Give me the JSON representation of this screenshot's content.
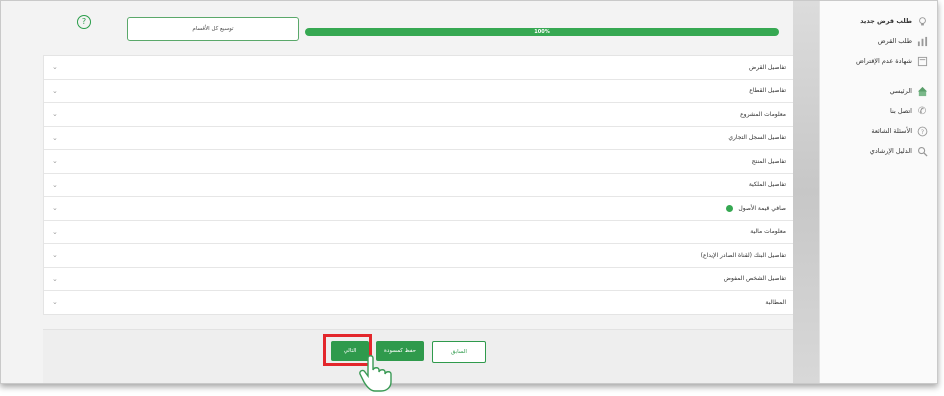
{
  "sidebar": {
    "items": [
      {
        "label": "طلب قرض جديد",
        "icon": "lightbulb-icon"
      },
      {
        "label": "طلب القرض",
        "icon": "bar-chart-icon"
      },
      {
        "label": "شهادة عدم الإقتراض",
        "icon": "document-icon"
      },
      {
        "label": "الرئيسي",
        "icon": "home-icon"
      },
      {
        "label": "اتصل بنا",
        "icon": "phone-icon"
      },
      {
        "label": "الأسئلة الشائعة",
        "icon": "help-circle-icon"
      },
      {
        "label": "الدليل الإرشادي",
        "icon": "search-icon"
      }
    ]
  },
  "header": {
    "help_icon": "?",
    "expand_all_label": "توسيع كل الأقسام",
    "progress_text": "100%",
    "progress_value": 100
  },
  "sections": [
    {
      "label": "تفاصيل القرض",
      "status": ""
    },
    {
      "label": "تفاصيل القطاع",
      "status": ""
    },
    {
      "label": "معلومات المشروع",
      "status": ""
    },
    {
      "label": "تفاصيل السجل التجاري",
      "status": ""
    },
    {
      "label": "تفاصيل المنتج",
      "status": ""
    },
    {
      "label": "تفاصيل الملكية",
      "status": ""
    },
    {
      "label": "صافي قيمة الأصول",
      "status": "complete"
    },
    {
      "label": "معلومات مالية",
      "status": ""
    },
    {
      "label": "تفاصيل البنك (لقناة الصادر الإيداع)",
      "status": ""
    },
    {
      "label": "تفاصيل الشخص المفوض",
      "status": ""
    },
    {
      "label": "المطالبة",
      "status": ""
    }
  ],
  "footer": {
    "next_label": "التالي",
    "save_label": "حفظ كمسودة",
    "back_label": "السابق"
  },
  "colors": {
    "accent": "#2f9a4c",
    "highlight": "#e3262b"
  }
}
